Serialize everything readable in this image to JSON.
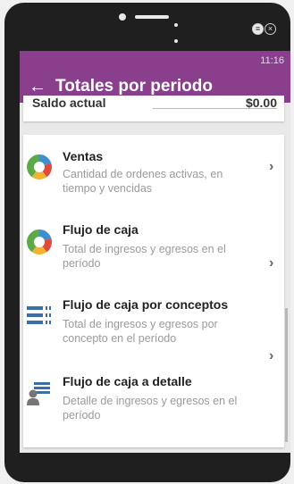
{
  "status_bar": {
    "time": "11:16"
  },
  "app_bar": {
    "back_icon": "←",
    "title": "Totales por periodo"
  },
  "previous_row": {
    "label": "Saldo actual",
    "value": "$0.00"
  },
  "items": [
    {
      "title": "Ventas",
      "description": "Cantidad de ordenes activas, en tiempo y vencidas",
      "icon": "pie-chart-icon"
    },
    {
      "title": "Flujo de caja",
      "description": "Total de ingresos y egresos en el período",
      "icon": "pie-chart-icon"
    },
    {
      "title": "Flujo de caja por conceptos",
      "description": "Total de ingresos y egresos por concepto en el período",
      "icon": "list-bars-icon"
    },
    {
      "title": "Flujo de caja a detalle",
      "description": "Detalle de ingresos y egresos en el período",
      "icon": "user-detail-icon"
    }
  ],
  "chevron": "›",
  "colors": {
    "app_bar": "#8a3f8d",
    "background": "#e9e9e9"
  }
}
